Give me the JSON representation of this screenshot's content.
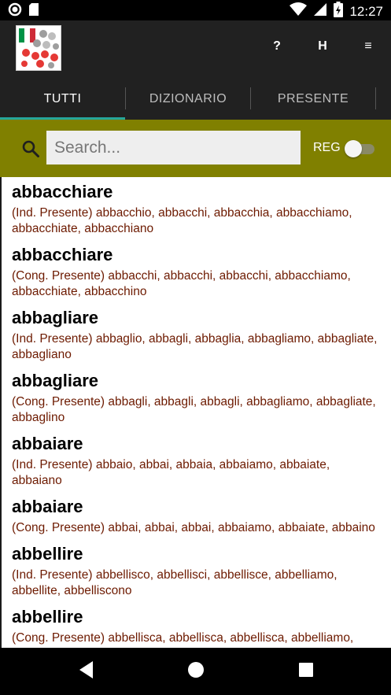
{
  "status": {
    "time": "12:27"
  },
  "header": {
    "actions": {
      "help": "?",
      "history": "H",
      "menu": "≡"
    },
    "tabs": [
      "TUTTI",
      "DIZIONARIO",
      "PRESENTE"
    ]
  },
  "search": {
    "placeholder": "Search...",
    "value": "",
    "reg_label": "REG",
    "reg_on": false
  },
  "results": [
    {
      "verb": "abbacchiare",
      "forms": "(Ind. Presente) abbacchio, abbacchi, abbacchia, abbacchiamo, abbacchiate, abbacchiano"
    },
    {
      "verb": "abbacchiare",
      "forms": "(Cong. Presente) abbacchi, abbacchi, abbacchi, abbacchiamo, abbacchiate, abbacchino"
    },
    {
      "verb": "abbagliare",
      "forms": "(Ind. Presente) abbaglio, abbagli, abbaglia, abbagliamo, abbagliate, abbagliano"
    },
    {
      "verb": "abbagliare",
      "forms": "(Cong. Presente) abbagli, abbagli, abbagli, abbagliamo, abbagliate, abbaglino"
    },
    {
      "verb": "abbaiare",
      "forms": "(Ind. Presente) abbaio, abbai, abbaia, abbaiamo, abbaiate, abbaiano"
    },
    {
      "verb": "abbaiare",
      "forms": "(Cong. Presente) abbai, abbai, abbai, abbaiamo, abbaiate, abbaino"
    },
    {
      "verb": "abbellire",
      "forms": "(Ind. Presente) abbellisco, abbellisci, abbellisce, abbelliamo, abbellite, abbelliscono"
    },
    {
      "verb": "abbellire",
      "forms": "(Cong. Presente) abbellisca, abbellisca, abbellisca, abbelliamo, abbelliate, abbelliscano"
    }
  ],
  "colors": {
    "appbar": "#212121",
    "searchbar": "#808000",
    "tab_indicator": "#26a69a",
    "forms_text": "#6d1a00"
  }
}
